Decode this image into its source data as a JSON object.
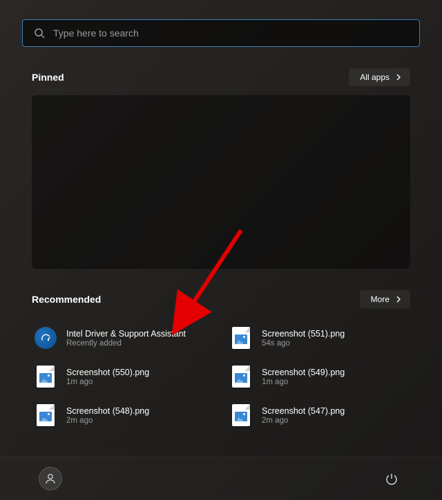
{
  "search": {
    "placeholder": "Type here to search"
  },
  "pinned": {
    "title": "Pinned",
    "all_apps_label": "All apps"
  },
  "recommended": {
    "title": "Recommended",
    "more_label": "More",
    "items": [
      {
        "title": "Intel Driver & Support Assistant",
        "sub": "Recently added",
        "icon": "intel"
      },
      {
        "title": "Screenshot (551).png",
        "sub": "54s ago",
        "icon": "image"
      },
      {
        "title": "Screenshot (550).png",
        "sub": "1m ago",
        "icon": "image"
      },
      {
        "title": "Screenshot (549).png",
        "sub": "1m ago",
        "icon": "image"
      },
      {
        "title": "Screenshot (548).png",
        "sub": "2m ago",
        "icon": "image"
      },
      {
        "title": "Screenshot (547).png",
        "sub": "2m ago",
        "icon": "image"
      }
    ]
  }
}
